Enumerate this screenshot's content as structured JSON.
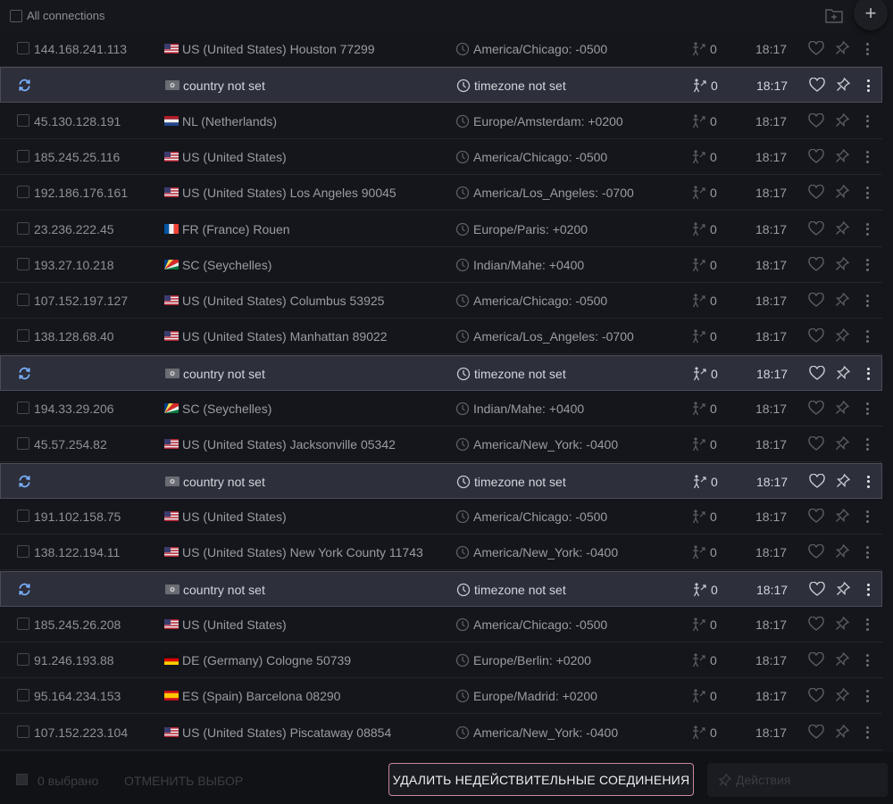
{
  "header": {
    "title": "All connections",
    "add_label": "+"
  },
  "rows": [
    {
      "type": "proxy",
      "ip": "144.168.241.113",
      "flag": "us",
      "country": "US (United States) Houston 77299",
      "timezone": "America/Chicago: -0500",
      "count": "0",
      "time": "18:17"
    },
    {
      "type": "invalid",
      "ip": "",
      "flag": "none",
      "country": "country not set",
      "timezone": "timezone not set",
      "count": "0",
      "time": "18:17"
    },
    {
      "type": "proxy",
      "ip": "45.130.128.191",
      "flag": "nl",
      "country": "NL (Netherlands)",
      "timezone": "Europe/Amsterdam: +0200",
      "count": "0",
      "time": "18:17"
    },
    {
      "type": "proxy",
      "ip": "185.245.25.116",
      "flag": "us",
      "country": "US (United States)",
      "timezone": "America/Chicago: -0500",
      "count": "0",
      "time": "18:17"
    },
    {
      "type": "proxy",
      "ip": "192.186.176.161",
      "flag": "us",
      "country": "US (United States) Los Angeles 90045",
      "timezone": "America/Los_Angeles: -0700",
      "count": "0",
      "time": "18:17"
    },
    {
      "type": "proxy",
      "ip": "23.236.222.45",
      "flag": "fr",
      "country": "FR (France) Rouen",
      "timezone": "Europe/Paris: +0200",
      "count": "0",
      "time": "18:17"
    },
    {
      "type": "proxy",
      "ip": "193.27.10.218",
      "flag": "sc",
      "country": "SC (Seychelles)",
      "timezone": "Indian/Mahe: +0400",
      "count": "0",
      "time": "18:17"
    },
    {
      "type": "proxy",
      "ip": "107.152.197.127",
      "flag": "us",
      "country": "US (United States) Columbus 53925",
      "timezone": "America/Chicago: -0500",
      "count": "0",
      "time": "18:17"
    },
    {
      "type": "proxy",
      "ip": "138.128.68.40",
      "flag": "us",
      "country": "US (United States) Manhattan 89022",
      "timezone": "America/Los_Angeles: -0700",
      "count": "0",
      "time": "18:17"
    },
    {
      "type": "invalid",
      "ip": "",
      "flag": "none",
      "country": "country not set",
      "timezone": "timezone not set",
      "count": "0",
      "time": "18:17"
    },
    {
      "type": "proxy",
      "ip": "194.33.29.206",
      "flag": "sc",
      "country": "SC (Seychelles)",
      "timezone": "Indian/Mahe: +0400",
      "count": "0",
      "time": "18:17"
    },
    {
      "type": "proxy",
      "ip": "45.57.254.82",
      "flag": "us",
      "country": "US (United States) Jacksonville 05342",
      "timezone": "America/New_York: -0400",
      "count": "0",
      "time": "18:17"
    },
    {
      "type": "invalid",
      "ip": "",
      "flag": "none",
      "country": "country not set",
      "timezone": "timezone not set",
      "count": "0",
      "time": "18:17"
    },
    {
      "type": "proxy",
      "ip": "191.102.158.75",
      "flag": "us",
      "country": "US (United States)",
      "timezone": "America/Chicago: -0500",
      "count": "0",
      "time": "18:17"
    },
    {
      "type": "proxy",
      "ip": "138.122.194.11",
      "flag": "us",
      "country": "US (United States) New York County 11743",
      "timezone": "America/New_York: -0400",
      "count": "0",
      "time": "18:17"
    },
    {
      "type": "invalid",
      "ip": "",
      "flag": "none",
      "country": "country not set",
      "timezone": "timezone not set",
      "count": "0",
      "time": "18:17"
    },
    {
      "type": "proxy",
      "ip": "185.245.26.208",
      "flag": "us",
      "country": "US (United States)",
      "timezone": "America/Chicago: -0500",
      "count": "0",
      "time": "18:17"
    },
    {
      "type": "proxy",
      "ip": "91.246.193.88",
      "flag": "de",
      "country": "DE (Germany) Cologne 50739",
      "timezone": "Europe/Berlin: +0200",
      "count": "0",
      "time": "18:17"
    },
    {
      "type": "proxy",
      "ip": "95.164.234.153",
      "flag": "es",
      "country": "ES (Spain) Barcelona 08290",
      "timezone": "Europe/Madrid: +0200",
      "count": "0",
      "time": "18:17"
    },
    {
      "type": "proxy",
      "ip": "107.152.223.104",
      "flag": "us",
      "country": "US (United States) Piscataway 08854",
      "timezone": "America/New_York: -0400",
      "count": "0",
      "time": "18:17"
    }
  ],
  "footer": {
    "selected_label": "0 выбрано",
    "cancel_label": "ОТМЕНИТЬ ВЫБОР",
    "delete_label": "УДАЛИТЬ НЕДЕЙСТВИТЕЛЬНЫЕ СОЕДИНЕНИЯ",
    "actions_label": "Действия"
  },
  "colors": {
    "background": "#15161b",
    "invalid_row": "#2d2f3a",
    "refresh_icon": "#7ab0ff",
    "delete_border": "#c9889a"
  }
}
